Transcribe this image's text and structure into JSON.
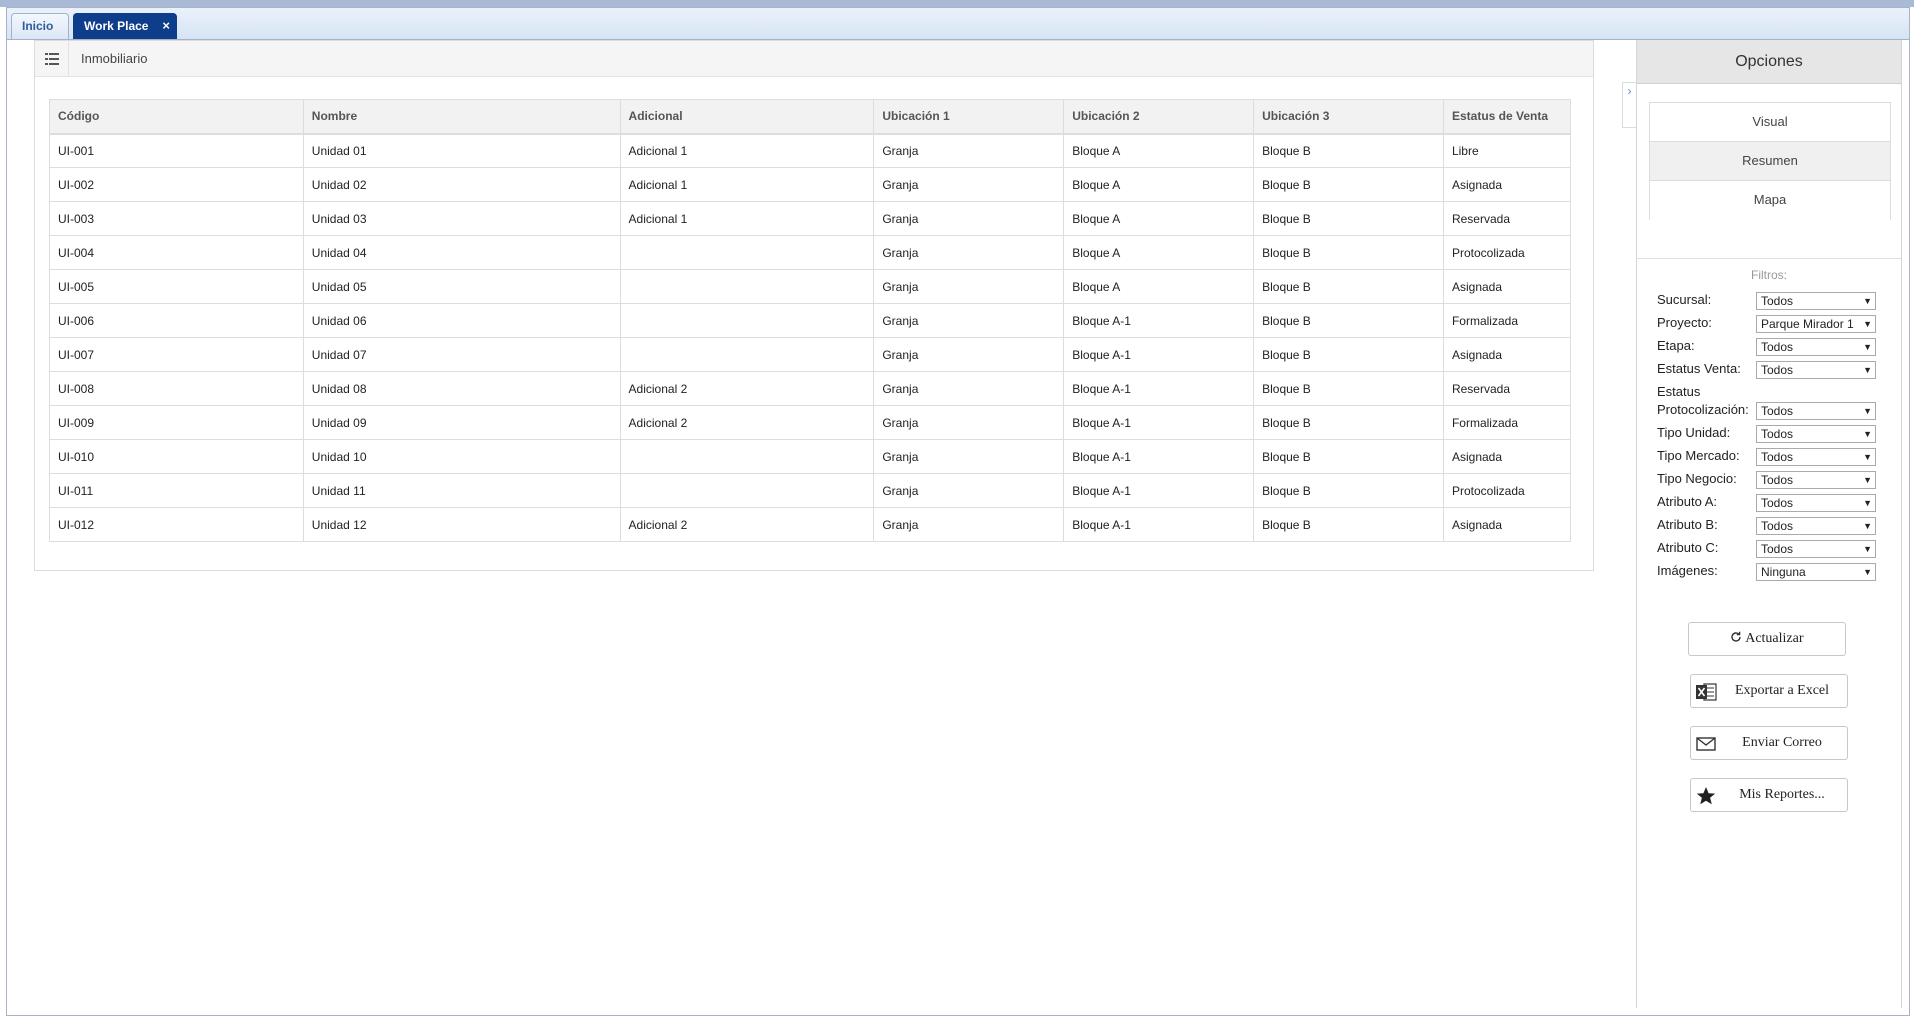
{
  "tabs": [
    {
      "label": "Inicio"
    },
    {
      "label": "Work Place",
      "close": "×"
    }
  ],
  "panel": {
    "title": "Inmobiliario"
  },
  "table": {
    "headers": [
      "Código",
      "Nombre",
      "Adicional",
      "Ubicación 1",
      "Ubicación 2",
      "Ubicación 3",
      "Estatus de Venta"
    ],
    "rows": [
      [
        "UI-001",
        "Unidad 01",
        "Adicional 1",
        "Granja",
        "Bloque A",
        "Bloque B",
        "Libre"
      ],
      [
        "UI-002",
        "Unidad 02",
        "Adicional 1",
        "Granja",
        "Bloque A",
        "Bloque B",
        "Asignada"
      ],
      [
        "UI-003",
        "Unidad 03",
        "Adicional 1",
        "Granja",
        "Bloque A",
        "Bloque B",
        "Reservada"
      ],
      [
        "UI-004",
        "Unidad 04",
        "",
        "Granja",
        "Bloque A",
        "Bloque B",
        "Protocolizada"
      ],
      [
        "UI-005",
        "Unidad 05",
        "",
        "Granja",
        "Bloque A",
        "Bloque B",
        "Asignada"
      ],
      [
        "UI-006",
        "Unidad 06",
        "",
        "Granja",
        "Bloque A-1",
        "Bloque B",
        "Formalizada"
      ],
      [
        "UI-007",
        "Unidad 07",
        "",
        "Granja",
        "Bloque A-1",
        "Bloque B",
        "Asignada"
      ],
      [
        "UI-008",
        "Unidad 08",
        "Adicional 2",
        "Granja",
        "Bloque A-1",
        "Bloque B",
        "Reservada"
      ],
      [
        "UI-009",
        "Unidad 09",
        "Adicional 2",
        "Granja",
        "Bloque A-1",
        "Bloque B",
        "Formalizada"
      ],
      [
        "UI-010",
        "Unidad 10",
        "",
        "Granja",
        "Bloque A-1",
        "Bloque B",
        "Asignada"
      ],
      [
        "UI-011",
        "Unidad 11",
        "",
        "Granja",
        "Bloque A-1",
        "Bloque B",
        "Protocolizada"
      ],
      [
        "UI-012",
        "Unidad 12",
        "Adicional 2",
        "Granja",
        "Bloque A-1",
        "Bloque B",
        "Asignada"
      ]
    ]
  },
  "side": {
    "title": "Opciones",
    "collapse_glyph": "›",
    "views": [
      "Visual",
      "Resumen",
      "Mapa"
    ],
    "selected_view": "Resumen",
    "filters_title": "Filtros:",
    "filters": [
      {
        "label": "Sucursal:",
        "value": "Todos"
      },
      {
        "label": "Proyecto:",
        "value": "Parque Mirador 1"
      },
      {
        "label": "Etapa:",
        "value": "Todos"
      },
      {
        "label": "Estatus Venta:",
        "value": "Todos"
      },
      {
        "label": "Estatus",
        "label2": "Protocolización:",
        "value": "Todos"
      },
      {
        "label": "Tipo Unidad:",
        "value": "Todos"
      },
      {
        "label": "Tipo Mercado:",
        "value": "Todos"
      },
      {
        "label": "Tipo Negocio:",
        "value": "Todos"
      },
      {
        "label": "Atributo A:",
        "value": "Todos"
      },
      {
        "label": "Atributo B:",
        "value": "Todos"
      },
      {
        "label": "Atributo C:",
        "value": "Todos"
      },
      {
        "label": "Imágenes:",
        "value": "Ninguna"
      }
    ],
    "actions": {
      "refresh": "Actualizar",
      "excel": "Exportar a Excel",
      "email": "Enviar Correo",
      "reports": "Mis Reportes..."
    }
  },
  "colors": {
    "active_tab": "#0e3d8c",
    "tab_strip": "#d7e4f4"
  }
}
